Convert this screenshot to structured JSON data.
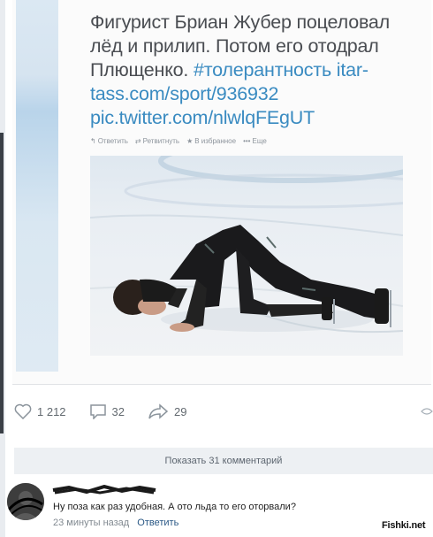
{
  "tweet": {
    "line1": "Фигурист Бриан Жубер поцеловал",
    "line2": "лёд и прилип. Потом его отодрал",
    "line3_text": "Плющенко. ",
    "line3_hashtag": "#толерантность",
    "line3_link": " itar-",
    "line4": "tass.com/sport/936932",
    "line5": "pic.twitter.com/nlwlqFEgUT",
    "actions": {
      "reply": "Ответить",
      "retweet": "Ретвитнуть",
      "favorite": "В избранное",
      "more": "Еще"
    }
  },
  "stats": {
    "likes": "1 212",
    "comments": "32",
    "shares": "29"
  },
  "show_comments_label": "Показать 31 комментарий",
  "comment": {
    "text": "Ну поза как раз удобная. А ото льда то его оторвали?",
    "time": "23 минуты назад",
    "reply_label": "Ответить"
  },
  "watermark": "Fishki.net",
  "colors": {
    "link": "#3a8bc1",
    "vk_blue": "#2a5885",
    "bar": "#edf0f3"
  },
  "icons": [
    "heart-icon",
    "comment-icon",
    "share-icon",
    "reply-icon",
    "retweet-icon",
    "star-icon",
    "more-icon"
  ]
}
